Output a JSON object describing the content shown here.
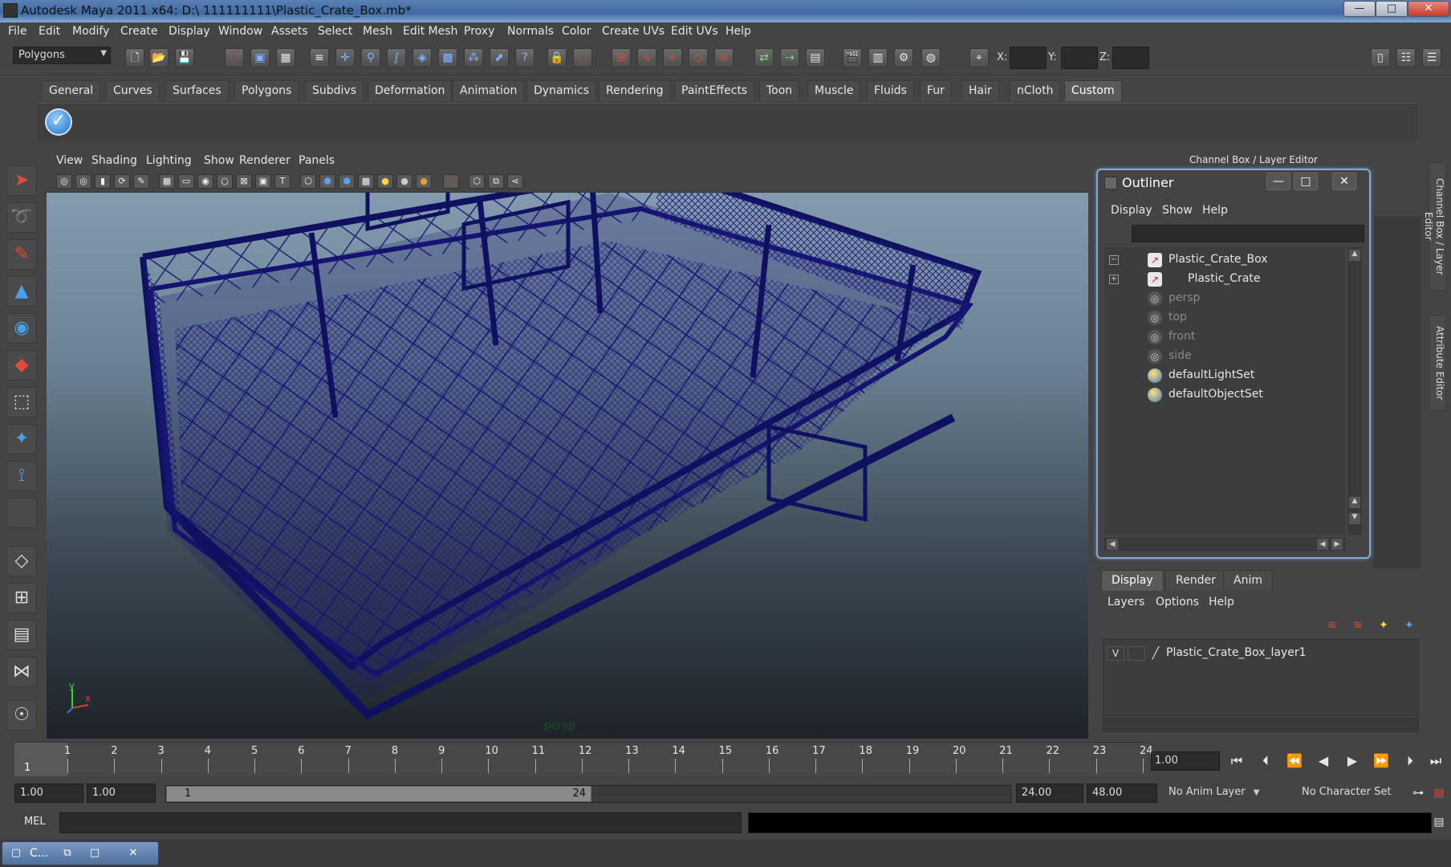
{
  "window": {
    "title": "Autodesk Maya 2011 x64: D:\\ 111111111\\Plastic_Crate_Box.mb*",
    "min": "—",
    "max": "□",
    "close": "✕"
  },
  "menubar": [
    "File",
    "Edit",
    "Modify",
    "Create",
    "Display",
    "Window",
    "Assets",
    "Select",
    "Mesh",
    "Edit Mesh",
    "Proxy",
    "Normals",
    "Color",
    "Create UVs",
    "Edit UVs",
    "Help"
  ],
  "toolbar": {
    "mode": "Polygons",
    "x_label": "X:",
    "y_label": "Y:",
    "z_label": "Z:"
  },
  "shelf": {
    "tabs": [
      "General",
      "Curves",
      "Surfaces",
      "Polygons",
      "Subdivs",
      "Deformation",
      "Animation",
      "Dynamics",
      "Rendering",
      "PaintEffects",
      "Toon",
      "Muscle",
      "Fluids",
      "Fur",
      "Hair",
      "nCloth",
      "Custom"
    ],
    "active_tab": "Custom"
  },
  "viewport": {
    "menu": [
      "View",
      "Shading",
      "Lighting",
      "Show",
      "Renderer",
      "Panels"
    ],
    "camera_label": "persp",
    "axis_y": "y",
    "axis_x": "x",
    "wire_color": "#1a1a7a"
  },
  "channelbox": {
    "header": "Channel Box / Layer Editor",
    "side_tab_1": "Channel Box / Layer Editor",
    "side_tab_2": "Attribute Editor"
  },
  "outliner": {
    "title": "Outliner",
    "menu": [
      "Display",
      "Show",
      "Help"
    ],
    "items": [
      {
        "label": "Plastic_Crate_Box",
        "type": "mesh",
        "expand": "−"
      },
      {
        "label": "Plastic_Crate",
        "type": "mesh",
        "expand": "+"
      },
      {
        "label": "persp",
        "type": "camera"
      },
      {
        "label": "top",
        "type": "camera"
      },
      {
        "label": "front",
        "type": "camera"
      },
      {
        "label": "side",
        "type": "camera"
      },
      {
        "label": "defaultLightSet",
        "type": "set"
      },
      {
        "label": "defaultObjectSet",
        "type": "set"
      }
    ]
  },
  "layer_editor": {
    "tabs": [
      "Display",
      "Render",
      "Anim"
    ],
    "active_tab": "Display",
    "menu": [
      "Layers",
      "Options",
      "Help"
    ],
    "layers": [
      {
        "visible": "V",
        "name": "Plastic_Crate_Box_layer1"
      }
    ]
  },
  "timeline": {
    "start": 1,
    "end": 24,
    "current_frame": "1",
    "frame_field": "1.00"
  },
  "range": {
    "start_time": "1.00",
    "playback_start": "1.00",
    "slider_start": "1",
    "slider_end": "24",
    "playback_end": "24.00",
    "end_time": "48.00",
    "anim_layer": "No Anim Layer",
    "character_set": "No Character Set"
  },
  "cmdline": {
    "label": "MEL"
  },
  "taskbar": {
    "label": "C..."
  }
}
